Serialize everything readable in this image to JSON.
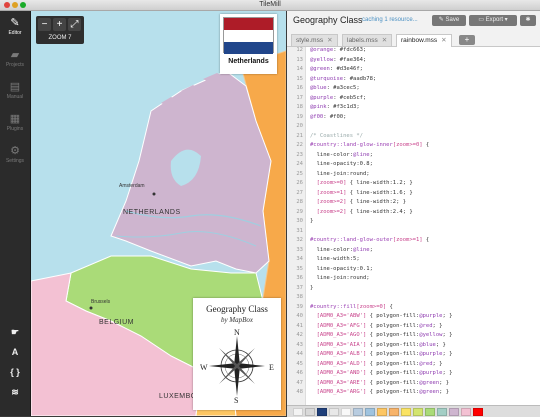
{
  "window": {
    "title": "TileMill"
  },
  "sidebar": {
    "items": [
      {
        "label": "Editor",
        "icon": "pencil-icon",
        "active": true
      },
      {
        "label": "Projects",
        "icon": "folder-icon"
      },
      {
        "label": "Manual",
        "icon": "book-icon"
      },
      {
        "label": "Plugins",
        "icon": "plugin-icon"
      },
      {
        "label": "Settings",
        "icon": "gear-icon"
      }
    ],
    "tools": [
      {
        "glyph": "☛",
        "icon": "pointer-icon"
      },
      {
        "glyph": "A",
        "icon": "font-icon"
      },
      {
        "glyph": "{ }",
        "icon": "braces-icon"
      },
      {
        "glyph": "≋",
        "icon": "layers-icon"
      }
    ]
  },
  "map": {
    "zoom_in": "+",
    "zoom_out": "−",
    "fullscreen": "⤢",
    "zoom_label": "ZOOM 7",
    "flag_caption": "Netherlands",
    "flag_colors": [
      "#ae1c28",
      "#ffffff",
      "#21468b"
    ],
    "legend_title": "Geography Class",
    "legend_subtitle": "by MapBox",
    "compass": {
      "n": "N",
      "s": "S",
      "e": "E",
      "w": "W"
    },
    "labels": {
      "amsterdam": "Amsterdam",
      "netherlands": "NETHERLANDS",
      "brussels": "Brussels",
      "belgium": "BELGIUM",
      "luxembourg": "LUXEMBOURG"
    }
  },
  "editor": {
    "project_title": "Geography Class",
    "status": "caching 1 resource...",
    "save_label": "Save",
    "export_label": "Export",
    "tabs": [
      {
        "label": "style.mss",
        "active": false
      },
      {
        "label": "labels.mss",
        "active": false
      },
      {
        "label": "rainbow.mss",
        "active": true
      }
    ],
    "add_tab": "+",
    "first_line": 12,
    "lines": [
      "@orange: #fdc663;",
      "@yellow: #fae364;",
      "@green: #d3e46f;",
      "@turquoise: #aadb78;",
      "@blue: #a3cec5;",
      "@purple: #ceb5cf;",
      "@pink: #f3c1d3;",
      "@f00: #f00;",
      "",
      "/* Coastlines */",
      "#country::land-glow-inner[zoom>=0] {",
      "  line-color:@line;",
      "  line-opacity:0.8;",
      "  line-join:round;",
      "  [zoom>=0] { line-width:1.2; }",
      "  [zoom>=1] { line-width:1.6; }",
      "  [zoom>=2] { line-width:2; }",
      "  [zoom>=2] { line-width:2.4; }",
      "}",
      "",
      "#country::land-glow-outer[zoom>=1] {",
      "  line-color:@line;",
      "  line-width:5;",
      "  line-opacity:0.1;",
      "  line-join:round;",
      "}",
      "",
      "#country::fill[zoom>=0] {",
      "  [ADM0_A3='ABW'] { polygon-fill:@purple; }",
      "  [ADM0_A3='AFG'] { polygon-fill:@red; }",
      "  [ADM0_A3='AGO'] { polygon-fill:@yellow; }",
      "  [ADM0_A3='AIA'] { polygon-fill:@blue; }",
      "  [ADM0_A3='ALB'] { polygon-fill:@purple; }",
      "  [ADM0_A3='ALD'] { polygon-fill:@red; }",
      "  [ADM0_A3='AND'] { polygon-fill:@purple; }",
      "  [ADM0_A3='ARE'] { polygon-fill:@green; }",
      "  [ADM0_A3='ARG'] { polygon-fill:@green; }"
    ],
    "swatches": [
      "#f3f3f3",
      "#d9d9d9",
      "#1f3f7a",
      "#e8e8e8",
      "#f8f8f8",
      "#b8cce0",
      "#9fc3df",
      "#fdc663",
      "#f7b36a",
      "#fae364",
      "#d3e46f",
      "#aadb78",
      "#a3cec5",
      "#ceb5cf",
      "#f3c1d3",
      "#ff0000"
    ]
  }
}
